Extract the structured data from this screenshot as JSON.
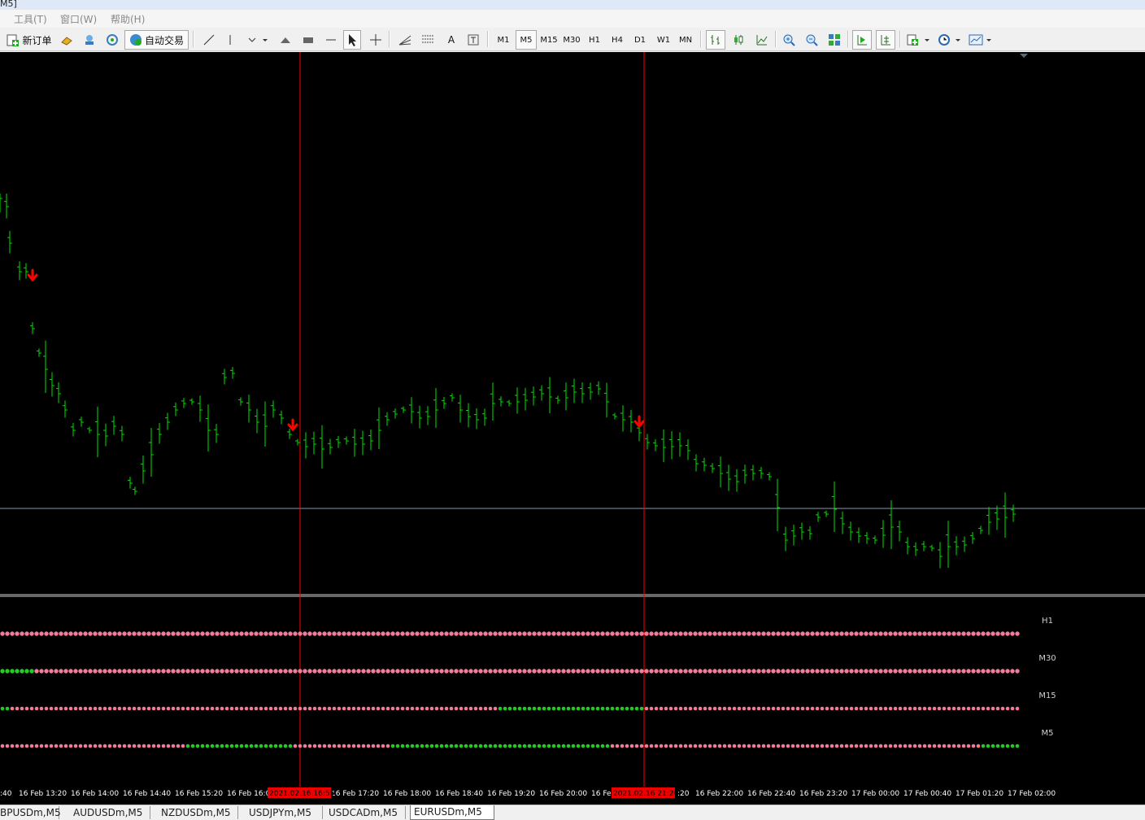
{
  "title_fragment": "M5]",
  "menu": [
    "工具(T)",
    "窗口(W)",
    "帮助(H)"
  ],
  "toolbar": {
    "new_order": "新订单",
    "auto_trading": "自动交易",
    "text_tool": "A",
    "timeframes": [
      "M1",
      "M5",
      "M15",
      "M30",
      "H1",
      "H4",
      "D1",
      "W1",
      "MN"
    ],
    "active_timeframe": "M5"
  },
  "chart": {
    "bar_color": "#00e000",
    "arrow_color": "#ff0000",
    "vline_color": "#ff0000",
    "price_line_color": "#8a9aa8",
    "dot_on_color": "#22cc22",
    "dot_off_color": "#f07c9a"
  },
  "indicator": {
    "rows": [
      {
        "label": "H1",
        "green_ranges": []
      },
      {
        "label": "M30",
        "green_ranges": [
          [
            0,
            6
          ]
        ]
      },
      {
        "label": "M15",
        "green_ranges": [
          [
            0,
            1
          ],
          [
            102,
            131
          ]
        ]
      },
      {
        "label": "M5",
        "green_ranges": [
          [
            38,
            59
          ],
          [
            80,
            124
          ],
          [
            201,
            209
          ]
        ]
      }
    ]
  },
  "time_axis": {
    "labels": [
      ":40",
      "16 Feb 13:20",
      "16 Feb 14:00",
      "16 Feb 14:40",
      "16 Feb 15:20",
      "16 Feb 16:0",
      "16 Feb 17:20",
      "16 Feb 18:00",
      "16 Feb 18:40",
      "16 Feb 19:20",
      "16 Feb 20:00",
      "16 Fe",
      ":20",
      "16 Feb 22:00",
      "16 Feb 22:40",
      "16 Feb 23:20",
      "17 Feb 00:00",
      "17 Feb 00:40",
      "17 Feb 01:20",
      "17 Feb 02:00"
    ],
    "highlights": [
      "2021.02.16 16:55",
      "2021.02.16 21:20"
    ]
  },
  "tabs": [
    "BPUSDm,M5",
    "AUDUSDm,M5",
    "NZDUSDm,M5",
    "USDJPYm,M5",
    "USDCADm,M5",
    "EURUSDm,M5"
  ],
  "active_tab": "EURUSDm,M5"
}
